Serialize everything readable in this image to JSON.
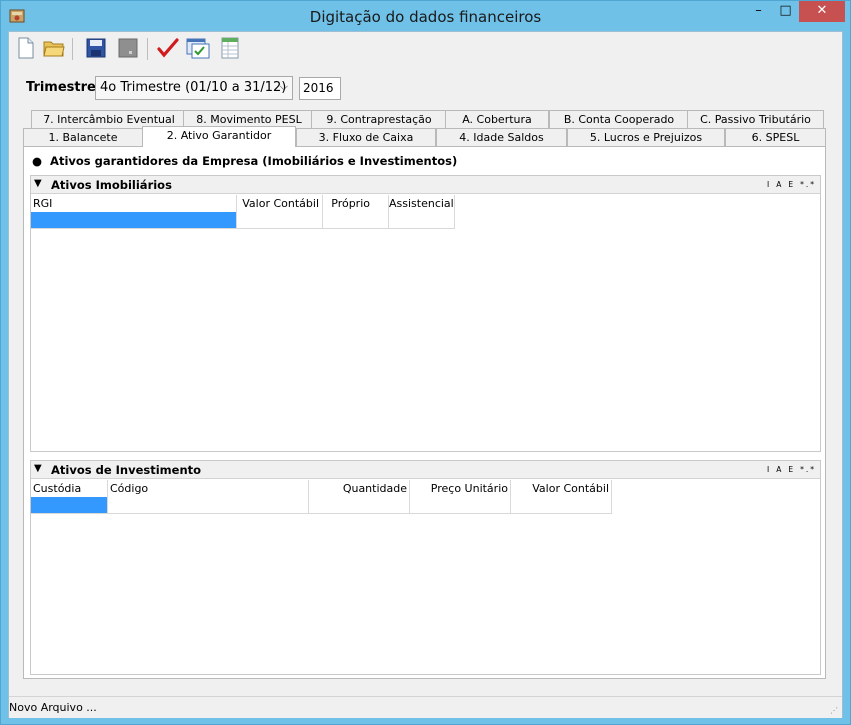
{
  "window": {
    "title": "Digitação do dados financeiros",
    "controls": {
      "minimize": "–",
      "maximize": "□",
      "close": "✕"
    }
  },
  "toolbar": {
    "buttons": [
      {
        "name": "new-file",
        "icon": "document-icon"
      },
      {
        "name": "open-folder",
        "icon": "folder-icon"
      },
      {
        "name": "save",
        "icon": "floppy-disk-icon"
      },
      {
        "name": "save-disabled",
        "icon": "floppy-disk-gray-icon"
      },
      {
        "name": "validate",
        "icon": "checkmark-icon"
      },
      {
        "name": "check-list",
        "icon": "checklist-window-icon"
      },
      {
        "name": "spreadsheet",
        "icon": "spreadsheet-icon"
      }
    ]
  },
  "trimestre": {
    "label": "Trimestre",
    "selected": "4o Trimestre (01/10 a 31/12)",
    "year": "2016"
  },
  "tabs": {
    "row_top": [
      "7. Intercâmbio Eventual",
      "8. Movimento PESL",
      "9. Contraprestação",
      "A. Cobertura",
      "B. Conta Cooperado",
      "C. Passivo Tributário"
    ],
    "row_bottom": [
      "1. Balancete",
      "2. Ativo Garantidor",
      "3. Fluxo de Caixa",
      "4. Idade Saldos",
      "5. Lucros e Prejuizos",
      "6. SPESL"
    ],
    "active": "2. Ativo Garantidor"
  },
  "panel": {
    "heading": "Ativos garantidores da Empresa (Imobiliários e Investimentos)",
    "imobiliarios": {
      "title": "Ativos Imobiliários",
      "filters": [
        "I",
        "A",
        "E",
        "*.*"
      ],
      "columns": [
        "RGI",
        "Valor Contábil",
        "Próprio",
        "Assistencial"
      ]
    },
    "investimento": {
      "title": "Ativos de Investimento",
      "filters": [
        "I",
        "A",
        "E",
        "*.*"
      ],
      "columns": [
        "Custódia",
        "Código",
        "Quantidade",
        "Preço Unitário",
        "Valor Contábil"
      ]
    }
  },
  "status": {
    "text": "Novo Arquivo ..."
  },
  "colors": {
    "titlebar": "#6fc1e8",
    "selection": "#3399ff",
    "close": "#c75050"
  }
}
